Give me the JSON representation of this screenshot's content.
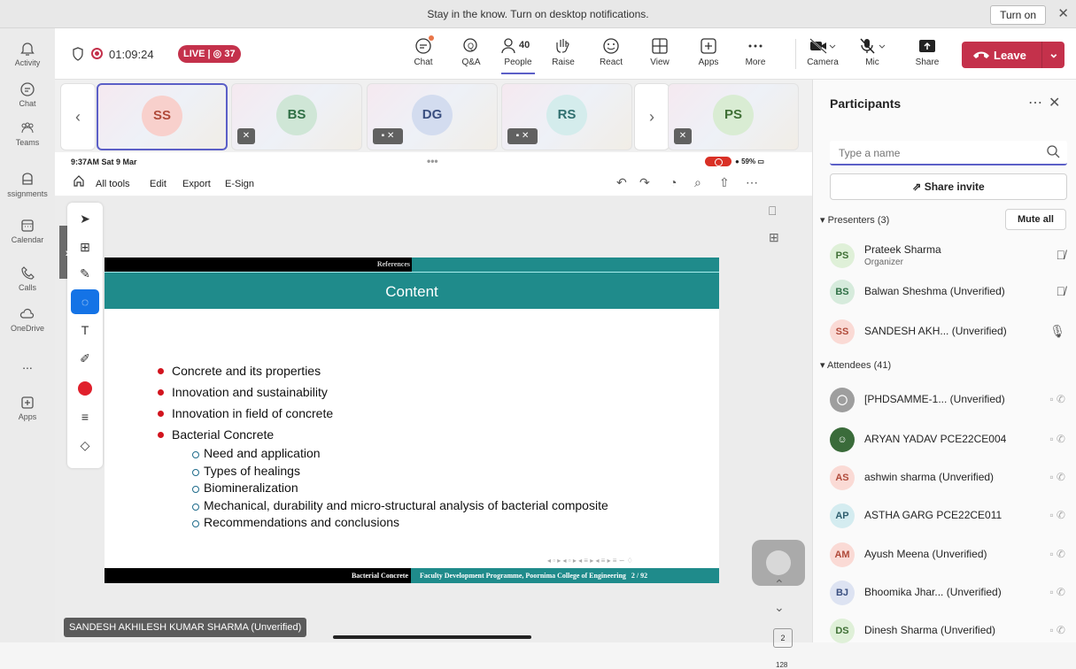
{
  "notification": {
    "message": "Stay in the know. Turn on desktop notifications.",
    "turn_on": "Turn on",
    "close": "✕"
  },
  "rail": [
    {
      "label": "Activity",
      "icon": "bell-icon"
    },
    {
      "label": "Chat",
      "icon": "chat-icon"
    },
    {
      "label": "Teams",
      "icon": "teams-icon"
    },
    {
      "label": "ssignments",
      "icon": "assignments-icon"
    },
    {
      "label": "Calendar",
      "icon": "calendar-icon"
    },
    {
      "label": "Calls",
      "icon": "phone-icon"
    },
    {
      "label": "OneDrive",
      "icon": "cloud-icon"
    },
    {
      "label": "...",
      "icon": "more-icon"
    },
    {
      "label": "Apps",
      "icon": "plus-icon"
    }
  ],
  "meeting": {
    "timer": "01:09:24",
    "live_label": "LIVE",
    "viewers": "37",
    "people_count": "40",
    "controls": {
      "chat": "Chat",
      "qa": "Q&A",
      "people": "People",
      "raise": "Raise",
      "react": "React",
      "view": "View",
      "apps": "Apps",
      "more": "More",
      "camera": "Camera",
      "mic": "Mic",
      "share": "Share",
      "leave": "Leave"
    }
  },
  "thumbnails": [
    {
      "initials": "SS",
      "color": "#f8d0cc",
      "text_color": "#b04a3a"
    },
    {
      "initials": "BS",
      "color": "#cfe6d6",
      "text_color": "#2f6f45"
    },
    {
      "initials": "DG",
      "color": "#d3dcef",
      "text_color": "#3a4f80"
    },
    {
      "initials": "RS",
      "color": "#d4ecec",
      "text_color": "#2f6f6f"
    },
    {
      "initials": "PS",
      "color": "#d9ecd3",
      "text_color": "#3f6f35"
    }
  ],
  "ipad": {
    "status_time": "9:37AM  Sat 9 Mar",
    "battery": "59%"
  },
  "acrobat": {
    "all_tools": "All tools",
    "edit": "Edit",
    "export": "Export",
    "esign": "E-Sign"
  },
  "slide": {
    "header_label": "References",
    "title": "Content",
    "bullets": [
      "Concrete and its properties",
      "Innovation and sustainability",
      "Innovation in field of concrete",
      "Bacterial Concrete"
    ],
    "sub_bullets": [
      "Need and application",
      "Types of healings",
      "Biomineralization",
      "Mechanical, durability and micro-structural analysis of bacterial composite",
      "Recommendations and conclusions"
    ],
    "footer_left": "Bacterial Concrete",
    "footer_right": "Faculty Development Programme, Poornima College of Engineering",
    "page": "2 / 92"
  },
  "viewer": {
    "page_box": "2",
    "total": "128"
  },
  "presenter_name": "SANDESH AKHILESH KUMAR SHARMA (Unverified)",
  "panel": {
    "title": "Participants",
    "search_placeholder": "Type a name",
    "share_invite": "Share invite",
    "presenters_label": "Presenters (3)",
    "mute_all": "Mute all",
    "attendees_label": "Attendees (41)",
    "presenters": [
      {
        "initials": "PS",
        "name": "Prateek Sharma",
        "role": "Organizer",
        "bg": "#dff0d8",
        "fg": "#3f6f35"
      },
      {
        "initials": "BS",
        "name": "Balwan Sheshma (Unverified)",
        "bg": "#d6ebdc",
        "fg": "#2f6f45"
      },
      {
        "initials": "SS",
        "name": "SANDESH AKH... (Unverified)",
        "bg": "#fadad5",
        "fg": "#b04a3a"
      }
    ],
    "attendees": [
      {
        "initials": "",
        "name": "[PHDSAMME-1... (Unverified)",
        "bg": "#9e9e9e",
        "fg": "#fff"
      },
      {
        "initials": "",
        "name": "ARYAN YADAV PCE22CE004",
        "bg": "#3a6b3a",
        "fg": "#fff"
      },
      {
        "initials": "AS",
        "name": "ashwin sharma (Unverified)",
        "bg": "#fadad5",
        "fg": "#b04a3a"
      },
      {
        "initials": "AP",
        "name": "ASTHA GARG PCE22CE011",
        "bg": "#d4ecf0",
        "fg": "#2f5f6f"
      },
      {
        "initials": "AM",
        "name": "Ayush Meena (Unverified)",
        "bg": "#fadad5",
        "fg": "#b04a3a"
      },
      {
        "initials": "BJ",
        "name": "Bhoomika Jhar... (Unverified)",
        "bg": "#dde3f2",
        "fg": "#3a4f80"
      },
      {
        "initials": "DS",
        "name": "Dinesh Sharma (Unverified)",
        "bg": "#dff0d8",
        "fg": "#3f6f35"
      }
    ]
  }
}
